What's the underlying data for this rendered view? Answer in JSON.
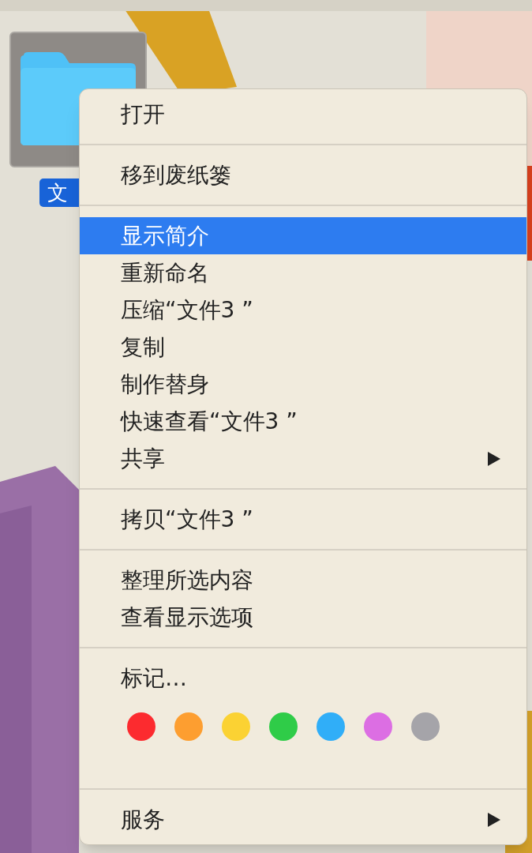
{
  "desktop": {
    "icon": {
      "label": "文",
      "selected": true
    }
  },
  "menu": {
    "sections": [
      {
        "kind": "items",
        "items": [
          {
            "label": "打开",
            "selected": false,
            "submenu": false
          }
        ]
      },
      {
        "kind": "items",
        "items": [
          {
            "label": "移到废纸篓",
            "selected": false,
            "submenu": false
          }
        ]
      },
      {
        "kind": "items",
        "items": [
          {
            "label": "显示简介",
            "selected": true,
            "submenu": false
          },
          {
            "label": "重新命名",
            "selected": false,
            "submenu": false
          },
          {
            "label": "压缩“文件3 ”",
            "selected": false,
            "submenu": false
          },
          {
            "label": "复制",
            "selected": false,
            "submenu": false
          },
          {
            "label": "制作替身",
            "selected": false,
            "submenu": false
          },
          {
            "label": "快速查看“文件3 ”",
            "selected": false,
            "submenu": false
          },
          {
            "label": "共享",
            "selected": false,
            "submenu": true
          }
        ]
      },
      {
        "kind": "items",
        "items": [
          {
            "label": "拷贝“文件3 ”",
            "selected": false,
            "submenu": false
          }
        ]
      },
      {
        "kind": "items",
        "items": [
          {
            "label": "整理所选内容",
            "selected": false,
            "submenu": false
          },
          {
            "label": "查看显示选项",
            "selected": false,
            "submenu": false
          }
        ]
      },
      {
        "kind": "tags",
        "label": "标记…",
        "tags": [
          {
            "color": "#fc2b2f"
          },
          {
            "color": "#fd9e30"
          },
          {
            "color": "#fbd233"
          },
          {
            "color": "#2fcc48"
          },
          {
            "color": "#30aef8"
          },
          {
            "color": "#dc6ee3"
          },
          {
            "color": "#a5a4a9"
          }
        ]
      },
      {
        "kind": "items",
        "items": [
          {
            "label": "服务",
            "selected": false,
            "submenu": true
          }
        ]
      }
    ]
  }
}
